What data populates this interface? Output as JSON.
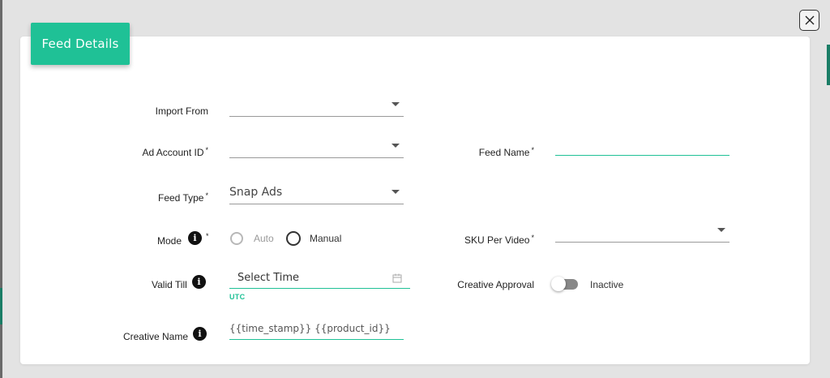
{
  "header": {
    "title": "Feed Details"
  },
  "close": {
    "label": "X"
  },
  "fields": {
    "import_from": {
      "label": "Import From",
      "value": ""
    },
    "ad_account_id": {
      "label": "Ad Account ID",
      "required": "*",
      "value": ""
    },
    "feed_name": {
      "label": "Feed Name",
      "required": "*",
      "value": ""
    },
    "feed_type": {
      "label": "Feed Type",
      "required": "*",
      "value": "Snap Ads"
    },
    "mode": {
      "label": "Mode",
      "required": "*",
      "options": [
        "Auto",
        "Manual"
      ],
      "disabled_option": "Auto"
    },
    "sku_per_video": {
      "label": "SKU Per Video",
      "required": "*",
      "value": ""
    },
    "valid_till": {
      "label": "Valid Till",
      "placeholder": "Select Time",
      "note": "UTC"
    },
    "creative_approval": {
      "label": "Creative Approval",
      "state": "Inactive"
    },
    "creative_name": {
      "label": "Creative Name",
      "value": "{{time_stamp}} {{product_id}}"
    }
  },
  "icons": {
    "info": "info-icon",
    "calendar": "calendar-icon",
    "close": "close-icon",
    "dropdown": "chevron-down-icon"
  },
  "colors": {
    "accent": "#1fc196",
    "backdrop": "#e3e3e3",
    "text": "#222222"
  }
}
